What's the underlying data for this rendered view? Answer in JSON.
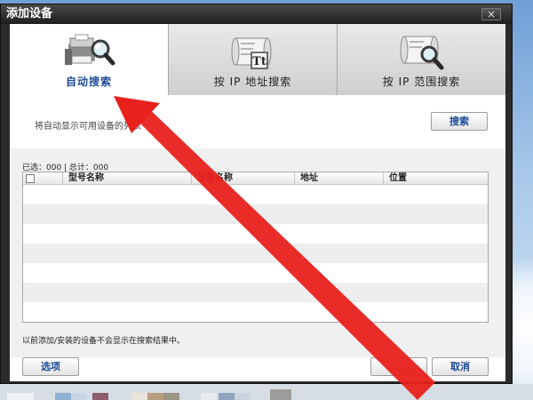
{
  "window": {
    "title": "添加设备",
    "close_glyph": "×"
  },
  "tabs": [
    {
      "label": "自动搜索",
      "icon": "printer-search-icon",
      "active": true
    },
    {
      "label": "按 IP 地址搜索",
      "icon": "scroll-text-icon",
      "active": false
    },
    {
      "label": "按 IP 范围搜索",
      "icon": "scroll-search-icon",
      "active": false
    }
  ],
  "auto_search": {
    "hint": "将自动显示可用设备的列表",
    "search_button": "搜索",
    "count_text": "已选：000 | 总计：000"
  },
  "table": {
    "columns": [
      "型号名称",
      "设备名称",
      "地址",
      "位置"
    ],
    "rows": []
  },
  "footer": {
    "note": "以前添加/安装的设备不会显示在搜索结果中。",
    "options_button": "选项",
    "add_button": "添加",
    "cancel_button": "取消"
  },
  "colors": {
    "accent": "#1c4b97",
    "annotation_arrow": "#e8211c",
    "titlebar": "#1e1e1e"
  }
}
